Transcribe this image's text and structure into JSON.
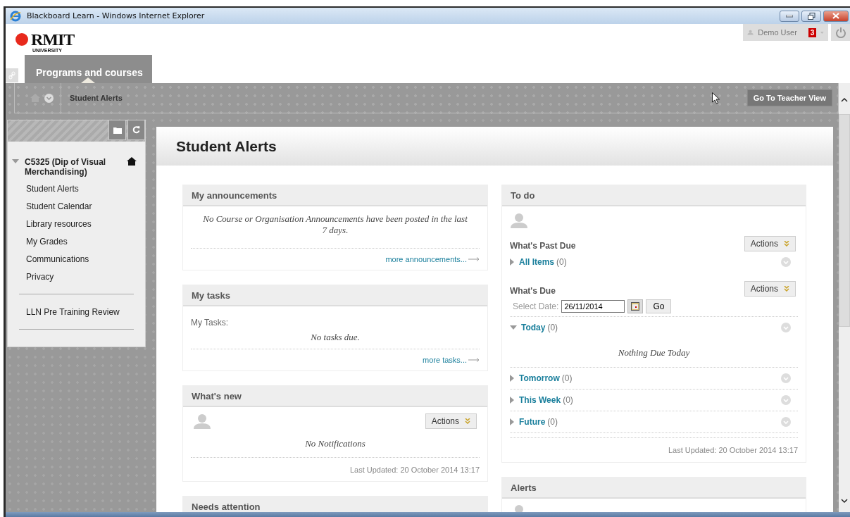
{
  "window": {
    "title": "Blackboard Learn - Windows Internet Explorer"
  },
  "header": {
    "logo_text": "RMIT",
    "logo_subtext": "UNIVERSITY",
    "user_name": "Demo User",
    "notification_count": "3"
  },
  "tabs": [
    {
      "label": "Programs and courses",
      "selected": true
    }
  ],
  "breadcrumb": {
    "current": "Student Alerts"
  },
  "teacher_view_button": "Go To Teacher View",
  "course_menu": {
    "course": {
      "title": "C5325 (Dip of Visual Merchandising)",
      "expanded": true
    },
    "items": [
      {
        "label": "Student Alerts"
      },
      {
        "label": "Student Calendar"
      },
      {
        "label": "Library resources"
      },
      {
        "label": "My Grades"
      },
      {
        "label": "Communications"
      },
      {
        "label": "Privacy"
      }
    ],
    "secondary_items": [
      {
        "label": "LLN Pre Training Review"
      }
    ]
  },
  "page_title": "Student Alerts",
  "left_modules": [
    {
      "kind": "message",
      "title": "My announcements",
      "message": "No Course or Organisation Announcements have been posted in the last 7 days.",
      "link": "more announcements..."
    },
    {
      "kind": "tasks",
      "title": "My tasks",
      "label": "My Tasks:",
      "message": "No tasks due.",
      "link": "more tasks..."
    },
    {
      "kind": "notifications",
      "title": "What's new",
      "action": "Actions",
      "message": "No Notifications",
      "updated": "Last Updated: 20 October 2014 13:17"
    },
    {
      "kind": "header_only",
      "title": "Needs attention"
    }
  ],
  "right_modules": [
    {
      "kind": "todo",
      "title": "To do",
      "past_due": {
        "heading": "What's Past Due",
        "action": "Actions",
        "groups": [
          {
            "label": "All Items",
            "count": "(0)",
            "expanded": false
          }
        ]
      },
      "due": {
        "heading": "What's Due",
        "action": "Actions",
        "date_label": "Select Date:",
        "date_value": "26/11/2014",
        "go": "Go",
        "groups": [
          {
            "label": "Today",
            "count": "(0)",
            "expanded": true,
            "empty_message": "Nothing Due Today"
          },
          {
            "label": "Tomorrow",
            "count": "(0)",
            "expanded": false
          },
          {
            "label": "This Week",
            "count": "(0)",
            "expanded": false
          },
          {
            "label": "Future",
            "count": "(0)",
            "expanded": false
          }
        ]
      },
      "updated": "Last Updated: 20 October 2014 13:17"
    },
    {
      "kind": "avatar",
      "title": "Alerts"
    }
  ]
}
